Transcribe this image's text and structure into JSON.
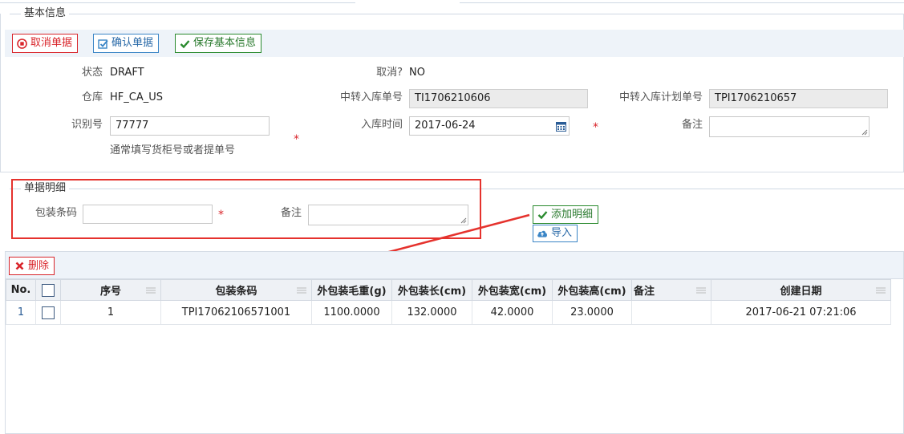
{
  "basic_section": {
    "legend": "基本信息",
    "toolbar": {
      "cancel_label": "取消单据",
      "confirm_label": "确认单据",
      "save_label": "保存基本信息"
    },
    "fields": {
      "status_label": "状态",
      "status_value": "DRAFT",
      "cancelled_label": "取消?",
      "cancelled_value": "NO",
      "warehouse_label": "仓库",
      "warehouse_value": "HF_CA_US",
      "transfer_no_label": "中转入库单号",
      "transfer_no_value": "TI1706210606",
      "plan_no_label": "中转入库计划单号",
      "plan_no_value": "TPI1706210657",
      "id_label": "识别号",
      "id_value": "77777",
      "id_hint": "通常填写货柜号或者提单号",
      "arrival_label": "入库时间",
      "arrival_value": "2017-06-24",
      "remark_label": "备注",
      "remark_value": ""
    }
  },
  "detail_section": {
    "legend": "单据明细",
    "barcode_label": "包装条码",
    "barcode_value": "",
    "remark_label": "备注",
    "remark_value": "",
    "add_label": "添加明细",
    "import_label": "导入"
  },
  "grid": {
    "delete_label": "删除",
    "columns": [
      "No.",
      "",
      "序号",
      "包装条码",
      "外包装毛重(g)",
      "外包装长(cm)",
      "外包装宽(cm)",
      "外包装高(cm)",
      "备注",
      "创建日期"
    ],
    "rows": [
      {
        "no": "1",
        "seq": "1",
        "barcode": "TPI17062106571001",
        "weight": "1100.0000",
        "length": "132.0000",
        "width": "42.0000",
        "height": "23.0000",
        "remark": "",
        "created": "2017-06-21 07:21:06"
      }
    ]
  },
  "colors": {
    "accent_red": "#d9252b",
    "accent_blue": "#3a85c6",
    "accent_green": "#2a8a2e",
    "toolbar_bg": "#eef3f9",
    "annotation_red": "#e5322d"
  }
}
